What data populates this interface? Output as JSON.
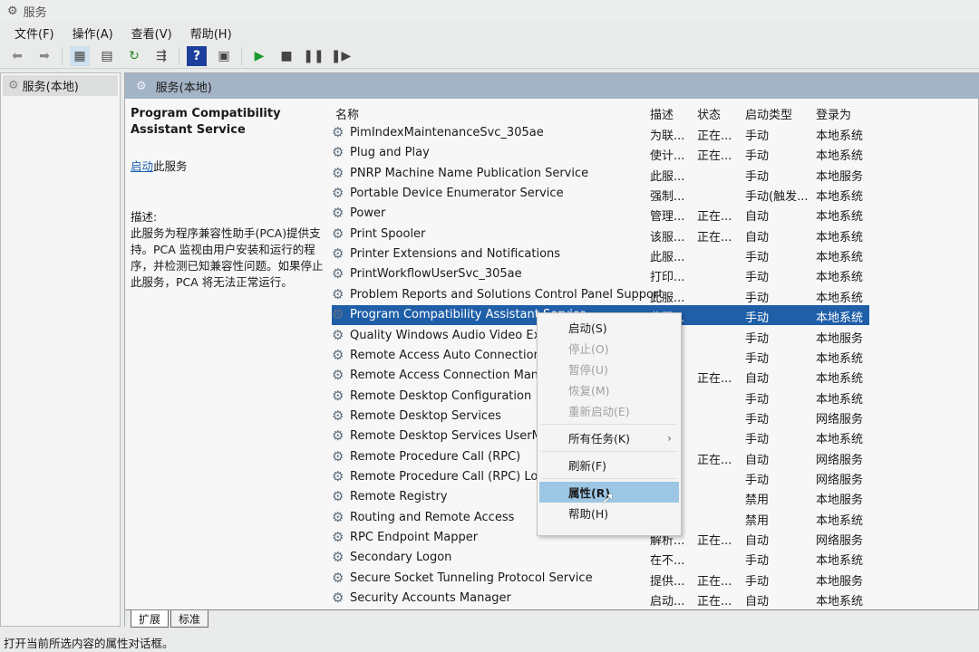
{
  "window": {
    "title": "服务",
    "icon": "gear-icon"
  },
  "menu": [
    "文件(F)",
    "操作(A)",
    "查看(V)",
    "帮助(H)"
  ],
  "toolbar": [
    "back-icon",
    "forward-icon",
    "show-tree-icon",
    "properties-icon",
    "refresh-icon",
    "export-icon",
    "help-icon",
    "console-icon",
    "play-icon",
    "stop-icon",
    "pause-icon",
    "resume-icon"
  ],
  "tree": {
    "root": "服务(本地)"
  },
  "header": {
    "title": "服务(本地)"
  },
  "desc": {
    "service_name": "Program Compatibility Assistant Service",
    "start_link": "启动",
    "start_suffix": "此服务",
    "desc_label": "描述:",
    "desc_text": "此服务为程序兼容性助手(PCA)提供支持。PCA 监视由用户安装和运行的程序，并检测已知兼容性问题。如果停止此服务，PCA 将无法正常运行。"
  },
  "columns": {
    "name": "名称",
    "desc": "描述",
    "status": "状态",
    "startup": "启动类型",
    "logon": "登录为"
  },
  "rows": [
    [
      "PimIndexMaintenanceSvc_305ae",
      "为联...",
      "正在...",
      "手动",
      "本地系统"
    ],
    [
      "Plug and Play",
      "使计...",
      "正在...",
      "手动",
      "本地系统"
    ],
    [
      "PNRP Machine Name Publication Service",
      "此服...",
      "",
      "手动",
      "本地服务"
    ],
    [
      "Portable Device Enumerator Service",
      "强制...",
      "",
      "手动(触发...",
      "本地系统"
    ],
    [
      "Power",
      "管理...",
      "正在...",
      "自动",
      "本地系统"
    ],
    [
      "Print Spooler",
      "该服...",
      "正在...",
      "自动",
      "本地系统"
    ],
    [
      "Printer Extensions and Notifications",
      "此服...",
      "",
      "手动",
      "本地系统"
    ],
    [
      "PrintWorkflowUserSvc_305ae",
      "打印...",
      "",
      "手动",
      "本地系统"
    ],
    [
      "Problem Reports and Solutions Control Panel Support",
      "此服...",
      "",
      "手动",
      "本地系统"
    ],
    [
      "Program Compatibility Assistant Service",
      "此服...",
      "",
      "手动",
      "本地系统"
    ],
    [
      "Quality Windows Audio Video Exper",
      "",
      "",
      "手动",
      "本地服务"
    ],
    [
      "Remote Access Auto Connection M",
      "",
      "",
      "手动",
      "本地系统"
    ],
    [
      "Remote Access Connection Manage",
      "",
      "正在...",
      "自动",
      "本地系统"
    ],
    [
      "Remote Desktop Configuration",
      "",
      "",
      "手动",
      "本地系统"
    ],
    [
      "Remote Desktop Services",
      "",
      "",
      "手动",
      "网络服务"
    ],
    [
      "Remote Desktop Services UserMod",
      "",
      "",
      "手动",
      "本地系统"
    ],
    [
      "Remote Procedure Call (RPC)",
      "",
      "正在...",
      "自动",
      "网络服务"
    ],
    [
      "Remote Procedure Call (RPC) Locato",
      "",
      "",
      "手动",
      "网络服务"
    ],
    [
      "Remote Registry",
      "",
      "",
      "禁用",
      "本地服务"
    ],
    [
      "Routing and Remote Access",
      "",
      "",
      "禁用",
      "本地系统"
    ],
    [
      "RPC Endpoint Mapper",
      "解析...",
      "正在...",
      "自动",
      "网络服务"
    ],
    [
      "Secondary Logon",
      "在不...",
      "",
      "手动",
      "本地系统"
    ],
    [
      "Secure Socket Tunneling Protocol Service",
      "提供...",
      "正在...",
      "手动",
      "本地服务"
    ],
    [
      "Security Accounts Manager",
      "启动...",
      "正在...",
      "自动",
      "本地系统"
    ]
  ],
  "selected_row": 9,
  "context_menu": [
    {
      "label": "启动(S)",
      "enabled": true
    },
    {
      "label": "停止(O)",
      "enabled": false
    },
    {
      "label": "暂停(U)",
      "enabled": false
    },
    {
      "label": "恢复(M)",
      "enabled": false
    },
    {
      "label": "重新启动(E)",
      "enabled": false
    },
    {
      "sep": true
    },
    {
      "label": "所有任务(K)",
      "enabled": true,
      "submenu": true
    },
    {
      "sep": true
    },
    {
      "label": "刷新(F)",
      "enabled": true
    },
    {
      "sep": true
    },
    {
      "label": "属性(R)",
      "enabled": true,
      "highlighted": true
    },
    {
      "label": "帮助(H)",
      "enabled": true
    }
  ],
  "tabs": [
    "扩展",
    "标准"
  ],
  "status": "打开当前所选内容的属性对话框。"
}
